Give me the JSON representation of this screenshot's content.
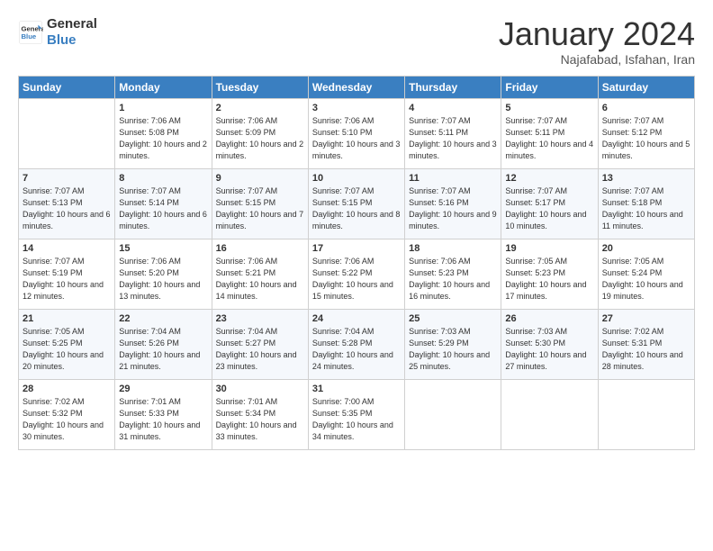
{
  "header": {
    "logo_line1": "General",
    "logo_line2": "Blue",
    "month": "January 2024",
    "location": "Najafabad, Isfahan, Iran"
  },
  "days_of_week": [
    "Sunday",
    "Monday",
    "Tuesday",
    "Wednesday",
    "Thursday",
    "Friday",
    "Saturday"
  ],
  "weeks": [
    [
      {
        "day": "",
        "sunrise": "",
        "sunset": "",
        "daylight": ""
      },
      {
        "day": "1",
        "sunrise": "7:06 AM",
        "sunset": "5:08 PM",
        "daylight": "10 hours and 2 minutes."
      },
      {
        "day": "2",
        "sunrise": "7:06 AM",
        "sunset": "5:09 PM",
        "daylight": "10 hours and 2 minutes."
      },
      {
        "day": "3",
        "sunrise": "7:06 AM",
        "sunset": "5:10 PM",
        "daylight": "10 hours and 3 minutes."
      },
      {
        "day": "4",
        "sunrise": "7:07 AM",
        "sunset": "5:11 PM",
        "daylight": "10 hours and 3 minutes."
      },
      {
        "day": "5",
        "sunrise": "7:07 AM",
        "sunset": "5:11 PM",
        "daylight": "10 hours and 4 minutes."
      },
      {
        "day": "6",
        "sunrise": "7:07 AM",
        "sunset": "5:12 PM",
        "daylight": "10 hours and 5 minutes."
      }
    ],
    [
      {
        "day": "7",
        "sunrise": "7:07 AM",
        "sunset": "5:13 PM",
        "daylight": "10 hours and 6 minutes."
      },
      {
        "day": "8",
        "sunrise": "7:07 AM",
        "sunset": "5:14 PM",
        "daylight": "10 hours and 6 minutes."
      },
      {
        "day": "9",
        "sunrise": "7:07 AM",
        "sunset": "5:15 PM",
        "daylight": "10 hours and 7 minutes."
      },
      {
        "day": "10",
        "sunrise": "7:07 AM",
        "sunset": "5:15 PM",
        "daylight": "10 hours and 8 minutes."
      },
      {
        "day": "11",
        "sunrise": "7:07 AM",
        "sunset": "5:16 PM",
        "daylight": "10 hours and 9 minutes."
      },
      {
        "day": "12",
        "sunrise": "7:07 AM",
        "sunset": "5:17 PM",
        "daylight": "10 hours and 10 minutes."
      },
      {
        "day": "13",
        "sunrise": "7:07 AM",
        "sunset": "5:18 PM",
        "daylight": "10 hours and 11 minutes."
      }
    ],
    [
      {
        "day": "14",
        "sunrise": "7:07 AM",
        "sunset": "5:19 PM",
        "daylight": "10 hours and 12 minutes."
      },
      {
        "day": "15",
        "sunrise": "7:06 AM",
        "sunset": "5:20 PM",
        "daylight": "10 hours and 13 minutes."
      },
      {
        "day": "16",
        "sunrise": "7:06 AM",
        "sunset": "5:21 PM",
        "daylight": "10 hours and 14 minutes."
      },
      {
        "day": "17",
        "sunrise": "7:06 AM",
        "sunset": "5:22 PM",
        "daylight": "10 hours and 15 minutes."
      },
      {
        "day": "18",
        "sunrise": "7:06 AM",
        "sunset": "5:23 PM",
        "daylight": "10 hours and 16 minutes."
      },
      {
        "day": "19",
        "sunrise": "7:05 AM",
        "sunset": "5:23 PM",
        "daylight": "10 hours and 17 minutes."
      },
      {
        "day": "20",
        "sunrise": "7:05 AM",
        "sunset": "5:24 PM",
        "daylight": "10 hours and 19 minutes."
      }
    ],
    [
      {
        "day": "21",
        "sunrise": "7:05 AM",
        "sunset": "5:25 PM",
        "daylight": "10 hours and 20 minutes."
      },
      {
        "day": "22",
        "sunrise": "7:04 AM",
        "sunset": "5:26 PM",
        "daylight": "10 hours and 21 minutes."
      },
      {
        "day": "23",
        "sunrise": "7:04 AM",
        "sunset": "5:27 PM",
        "daylight": "10 hours and 23 minutes."
      },
      {
        "day": "24",
        "sunrise": "7:04 AM",
        "sunset": "5:28 PM",
        "daylight": "10 hours and 24 minutes."
      },
      {
        "day": "25",
        "sunrise": "7:03 AM",
        "sunset": "5:29 PM",
        "daylight": "10 hours and 25 minutes."
      },
      {
        "day": "26",
        "sunrise": "7:03 AM",
        "sunset": "5:30 PM",
        "daylight": "10 hours and 27 minutes."
      },
      {
        "day": "27",
        "sunrise": "7:02 AM",
        "sunset": "5:31 PM",
        "daylight": "10 hours and 28 minutes."
      }
    ],
    [
      {
        "day": "28",
        "sunrise": "7:02 AM",
        "sunset": "5:32 PM",
        "daylight": "10 hours and 30 minutes."
      },
      {
        "day": "29",
        "sunrise": "7:01 AM",
        "sunset": "5:33 PM",
        "daylight": "10 hours and 31 minutes."
      },
      {
        "day": "30",
        "sunrise": "7:01 AM",
        "sunset": "5:34 PM",
        "daylight": "10 hours and 33 minutes."
      },
      {
        "day": "31",
        "sunrise": "7:00 AM",
        "sunset": "5:35 PM",
        "daylight": "10 hours and 34 minutes."
      },
      {
        "day": "",
        "sunrise": "",
        "sunset": "",
        "daylight": ""
      },
      {
        "day": "",
        "sunrise": "",
        "sunset": "",
        "daylight": ""
      },
      {
        "day": "",
        "sunrise": "",
        "sunset": "",
        "daylight": ""
      }
    ]
  ],
  "labels": {
    "sunrise_prefix": "Sunrise: ",
    "sunset_prefix": "Sunset: ",
    "daylight_prefix": "Daylight: "
  }
}
